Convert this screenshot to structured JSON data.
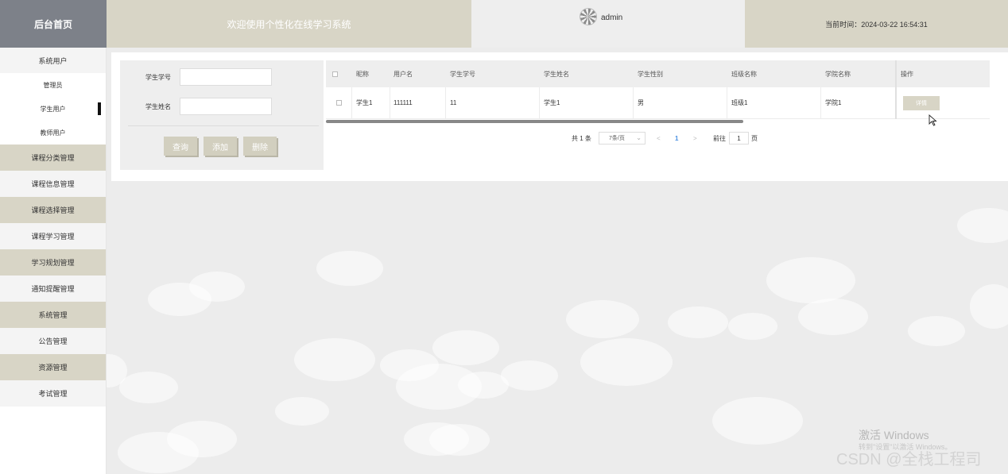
{
  "header": {
    "brand": "后台首页",
    "welcome": "欢迎使用个性化在线学习系统",
    "username": "admin",
    "time_label": "当前时间：2024-03-22 16:54:31"
  },
  "sidebar": {
    "group_title": "系统用户",
    "sub_items": [
      "管理员",
      "学生用户",
      "教师用户"
    ],
    "items": [
      "课程分类管理",
      "课程信息管理",
      "课程选择管理",
      "课程学习管理",
      "学习规划管理",
      "通知提醒管理",
      "系统管理",
      "公告管理",
      "资源管理",
      "考试管理"
    ]
  },
  "search": {
    "student_no_label": "学生学号",
    "student_name_label": "学生姓名",
    "query_btn": "查询",
    "add_btn": "添加",
    "delete_btn": "删除"
  },
  "table": {
    "headers": [
      "昵称",
      "用户名",
      "学生学号",
      "学生姓名",
      "学生性别",
      "班级名称",
      "学院名称",
      "操作"
    ],
    "rows": [
      [
        "学生1",
        "111111",
        "11",
        "学生1",
        "男",
        "班级1",
        "学院1",
        "详情"
      ]
    ]
  },
  "pagination": {
    "total": "共 1 条",
    "page_size": "7条/页",
    "prev": "<",
    "current": "1",
    "next": ">",
    "goto_label": "前往",
    "goto_value": "1",
    "page_suffix": "页"
  },
  "watermark": {
    "activate": "激活 Windows",
    "activate_hint": "转到\"设置\"以激活 Windows。",
    "csdn": "CSDN @全栈工程司"
  }
}
